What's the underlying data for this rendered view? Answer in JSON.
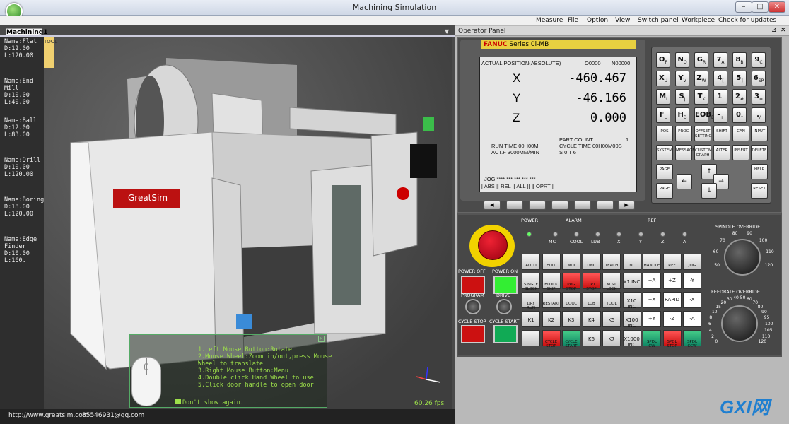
{
  "window": {
    "title": "Machining Simulation"
  },
  "menu": [
    "Measure",
    "File",
    "Option",
    "View",
    "Switch panel",
    "Workpiece",
    "Check for updates"
  ],
  "doc_tab": "Machining1",
  "tool_tag": "TOOL",
  "tools": [
    "Name:Flat\nD:12.00\nL:120.00",
    "Name:End\nMill\nD:10.00\nL:40.00",
    "Name:Ball\nD:12.00\nL:83.00",
    "Name:Drill\nD:10.00\nL:120.00",
    "Name:Boring\nD:18.00\nL:120.00",
    "Name:Edge\nFinder\nD:10.00\nL:160."
  ],
  "machine_brand": "GreatSim",
  "hints": [
    "1.Left Mouse Button:Rotate",
    "2.Mouse Wheel:Zoom in/out,press Mouse",
    "Wheel to translate",
    "3.Right Mouse Button:Menu",
    "4.Double click Hand Wheel to use",
    "5.Click door handle to open door"
  ],
  "dont_show": "Don't show again.",
  "fps": "60.26 fps",
  "status": {
    "url": "http://www.greatsim.com",
    "qq": "85546931@qq.com"
  },
  "operator_panel": {
    "title": "Operator Panel",
    "fanuc_brand": "FANUC",
    "fanuc_series": " Series 0i-MB",
    "lcd": {
      "header": "ACTUAL POSITION(ABSOLUTE)",
      "prog": "O0000",
      "seq": "N00000",
      "axes": [
        {
          "label": "X",
          "value": "-460.467"
        },
        {
          "label": "Y",
          "value": "-46.166"
        },
        {
          "label": "Z",
          "value": "0.000"
        }
      ],
      "part_count_label": "PART COUNT",
      "part_count": "1",
      "run_time": "RUN TIME   00H00M",
      "cycle_time": "CYCLE TIME  00H00M00S",
      "actf": "ACT.F  3000MM/MIN",
      "sot": "S   0   T   6",
      "mode_line": "JOG  ****   ***    ***       ***        ***",
      "soft_keys": "[   ABS   ][   REL   ][   ALL   ][         ][   OPRT   ]"
    },
    "address_keys": [
      [
        "O",
        "P"
      ],
      [
        "N",
        "Q"
      ],
      [
        "G",
        "R"
      ],
      [
        "7",
        "A"
      ],
      [
        "8",
        "B"
      ],
      [
        "9",
        "C"
      ],
      [
        "X",
        "U"
      ],
      [
        "Y",
        "V"
      ],
      [
        "Z",
        "W"
      ],
      [
        "4",
        "["
      ],
      [
        "5",
        "]"
      ],
      [
        "6",
        "SP"
      ],
      [
        "M",
        "I"
      ],
      [
        "S",
        "J"
      ],
      [
        "T",
        "K"
      ],
      [
        "1",
        ","
      ],
      [
        "2",
        "#"
      ],
      [
        "3",
        "="
      ],
      [
        "F",
        "L"
      ],
      [
        "H",
        "D"
      ],
      [
        "EOB",
        "E"
      ],
      [
        "-",
        "+"
      ],
      [
        "0",
        "*"
      ],
      [
        ".",
        "/"
      ]
    ],
    "function_keys": [
      "POS",
      "PROG",
      "OFFSET SETTING",
      "SHIFT",
      "CAN",
      "INPUT",
      "SYSTEM",
      "MESSAGE",
      "CUSTOM GRAPH",
      "ALTER",
      "INSERT",
      "DELETE",
      "PAGE",
      "HELP",
      "PAGE",
      "RESET"
    ],
    "labels": {
      "power": "POWER",
      "alarm": "ALARM",
      "ref": "REF",
      "power_off": "POWER OFF",
      "power_on": "POWER ON",
      "program": "PROGRAM",
      "drive": "DRIVE",
      "cycle_stop": "CYCLE STOP",
      "cycle_start": "CYCLE START",
      "spindle_override": "SPINDLE OVERRIDE",
      "feedrate_override": "FEEDRATE OVERRIDE"
    },
    "alarm_leds": [
      "MC",
      "COOL",
      "LUB"
    ],
    "ref_leds": [
      "X",
      "Y",
      "Z",
      "A"
    ],
    "mode_keys": [
      "AUTO",
      "EDIT",
      "MDI",
      "DNC",
      "TEACH",
      "INC",
      "HANDLE",
      "REF",
      "JOG",
      "SINGLE BLOCK",
      "BLOCK SKIP",
      "PRG STOP",
      "OPT STOP",
      "M.ST LOCK",
      "X1 INC",
      "+A",
      "+Z",
      "-Y",
      "DRY RUN",
      "RESTART",
      "COOL",
      "LUB",
      "TOOL",
      "X10 INC",
      "+X",
      "RAPID",
      "-X",
      "K1",
      "K2",
      "K3",
      "K4",
      "K5",
      "X100 INC",
      "+Y",
      "-Z",
      "-A",
      "",
      "CYCLE STOP",
      "CYCLE START",
      "K6",
      "K7",
      "X1000 INC",
      "SPDL CW",
      "SPDL STOP",
      "SPDL CCW"
    ],
    "spindle_scale": [
      "50",
      "60",
      "70",
      "80",
      "90",
      "100",
      "110",
      "120"
    ],
    "feed_scale": [
      "0",
      "2",
      "4",
      "6",
      "8",
      "10",
      "15",
      "20",
      "30",
      "40",
      "50",
      "60",
      "70",
      "80",
      "90",
      "95",
      "100",
      "105",
      "110",
      "120"
    ]
  },
  "watermark": "GXI网"
}
